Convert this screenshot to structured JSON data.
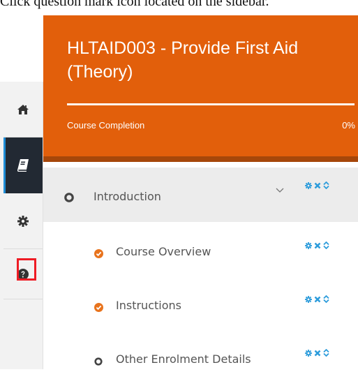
{
  "instruction": "Click question mark icon located on the sidebar.",
  "sidebar": {
    "items": [
      {
        "icon": "home-icon"
      },
      {
        "icon": "book-icon",
        "active": true
      },
      {
        "icon": "gear-icon"
      },
      {
        "icon": "question-circle-icon",
        "highlighted": true
      }
    ],
    "active_color": "#222933",
    "highlight_color": "#ee1c25"
  },
  "header": {
    "title": "HLTAID003 - Provide First Aid (Theory)",
    "completion_label": "Course Completion",
    "completion_value": "0%",
    "completion_fraction": 0,
    "background_color": "#e25f0b"
  },
  "outline": {
    "section": {
      "label": "Introduction",
      "status": "not-started"
    },
    "items": [
      {
        "label": "Course Overview",
        "status": "completed"
      },
      {
        "label": "Instructions",
        "status": "completed"
      },
      {
        "label": "Other Enrolment Details",
        "status": "not-started"
      }
    ],
    "action_icons": [
      "gear-icon",
      "close-icon",
      "sort-icon"
    ],
    "action_color": "#2d9cdb",
    "completed_color": "#e8731d"
  }
}
